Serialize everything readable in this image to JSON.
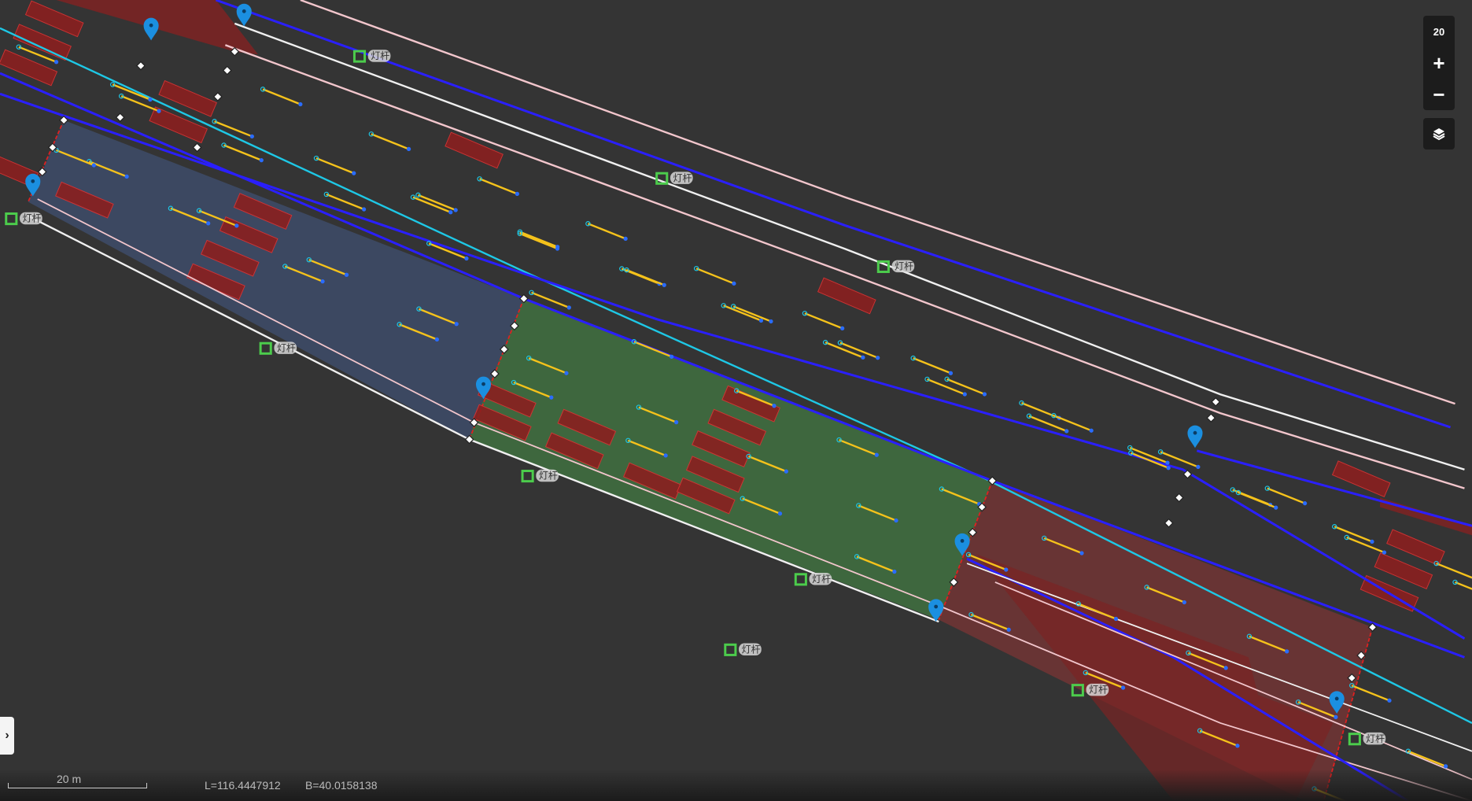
{
  "map": {
    "pole_label": "灯杆",
    "colors": {
      "background": "#343434",
      "lane_blue": "#2a1fff",
      "lane_cyan": "#1ec8e6",
      "edge_white": "#f0f0f0",
      "edge_pink": "#f2c6cc",
      "segment_yellow": "#f5c21b",
      "area_blue": "#3d4a66",
      "area_green": "#3f6a3f",
      "area_red": "#6e3434",
      "pole_green": "#4ccc4c",
      "pin_blue": "#1b8fe0"
    }
  },
  "controls": {
    "zoom_level": "20",
    "zoom_in": "+",
    "zoom_out": "−",
    "layers_icon": "layers-icon"
  },
  "sidebar_toggle": "›",
  "status": {
    "scale_label": "20 m",
    "longitude": "L=116.4447912",
    "latitude": "B=40.0158138"
  }
}
